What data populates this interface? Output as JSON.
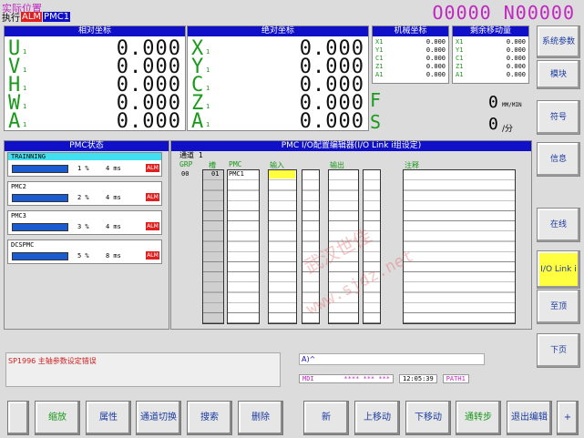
{
  "header": {
    "title": "实际位置",
    "mode_label": "执行",
    "mode_badge": "ALM",
    "path_badge": "PMC1",
    "program": "O0000 N00000"
  },
  "relative_coords": {
    "title": "相对坐标",
    "axes": [
      {
        "name": "U",
        "sub": "1",
        "value": "0.000"
      },
      {
        "name": "V",
        "sub": "1",
        "value": "0.000"
      },
      {
        "name": "H",
        "sub": "1",
        "value": "0.000"
      },
      {
        "name": "W",
        "sub": "1",
        "value": "0.000"
      },
      {
        "name": "A",
        "sub": "1",
        "value": "0.000"
      }
    ]
  },
  "absolute_coords": {
    "title": "绝对坐标",
    "axes": [
      {
        "name": "X",
        "sub": "1",
        "value": "0.000"
      },
      {
        "name": "Y",
        "sub": "1",
        "value": "0.000"
      },
      {
        "name": "C",
        "sub": "1",
        "value": "0.000"
      },
      {
        "name": "Z",
        "sub": "1",
        "value": "0.000"
      },
      {
        "name": "A",
        "sub": "1",
        "value": "0.000"
      }
    ]
  },
  "machine_coords": {
    "title": "机械坐标",
    "axes": [
      {
        "name": "X1",
        "value": "0.000"
      },
      {
        "name": "Y1",
        "value": "0.000"
      },
      {
        "name": "C1",
        "value": "0.000"
      },
      {
        "name": "Z1",
        "value": "0.000"
      },
      {
        "name": "A1",
        "value": "0.000"
      }
    ]
  },
  "remaining": {
    "title": "剩余移动量",
    "axes": [
      {
        "name": "X1",
        "value": "0.000"
      },
      {
        "name": "Y1",
        "value": "0.000"
      },
      {
        "name": "C1",
        "value": "0.000"
      },
      {
        "name": "Z1",
        "value": "0.000"
      },
      {
        "name": "A1",
        "value": "0.000"
      }
    ]
  },
  "feed": {
    "f_label": "F",
    "s_label": "S",
    "f_value": "0",
    "f_unit": "MM/MIN",
    "s_value": "0",
    "s_unit": "/分"
  },
  "pmc_status": {
    "title": "PMC状态",
    "items": [
      {
        "name": "TRAINNING",
        "load": 0.01,
        "percent": "1 %",
        "time": "4 ms",
        "alarm": "ALM"
      },
      {
        "name": "PMC2",
        "load": 0.02,
        "percent": "2 %",
        "time": "4 ms",
        "alarm": "ALM"
      },
      {
        "name": "PMC3",
        "load": 0.03,
        "percent": "3 %",
        "time": "4 ms",
        "alarm": "ALM"
      },
      {
        "name": "DCSPMC",
        "load": 0.05,
        "percent": "5 %",
        "time": "8 ms",
        "alarm": "ALM"
      }
    ]
  },
  "io_config": {
    "title": "PMC I/O配置编辑器(I/O Link i组设定)",
    "channel": "通道 1",
    "headers": {
      "grp": "GRP",
      "slot": "槽",
      "pmc": "PMC",
      "input": "输入",
      "output": "输出",
      "comment": "注释"
    },
    "row": {
      "grp": "00",
      "slot": "01",
      "pmc": "PMC1"
    }
  },
  "message": {
    "error": "SP1996 主轴参数设定错误",
    "input_prompt": "A)^",
    "status": {
      "mode": "MDI",
      "stars": "**** *** ***",
      "time": "12:05:39",
      "path": "PATH1"
    }
  },
  "watermark": {
    "cn": "武汉世佳",
    "url": "www.sjdz.net"
  },
  "right_softkeys": [
    {
      "label": "系统参数",
      "active": false
    },
    {
      "label": "模块",
      "active": false
    },
    {
      "label": "符号",
      "active": false
    },
    {
      "label": "信息",
      "active": false
    },
    {
      "label": "在线",
      "active": false
    },
    {
      "label": "I/O Link i",
      "active": true
    },
    {
      "label": "至顶",
      "active": false
    },
    {
      "label": "下页",
      "active": false
    }
  ],
  "bottom_softkeys": [
    {
      "label": "",
      "special": "blank"
    },
    {
      "label": "缩放",
      "green": true
    },
    {
      "label": "属性"
    },
    {
      "label": "通道切换"
    },
    {
      "label": "搜索"
    },
    {
      "label": "删除"
    },
    {
      "label": "新"
    },
    {
      "label": "上移动"
    },
    {
      "label": "下移动"
    },
    {
      "label": "通转步",
      "green": true
    },
    {
      "label": "退出编辑"
    },
    {
      "label": "+"
    }
  ],
  "colors": {
    "accent_header": "#1010c8",
    "axis_green": "#1a9a1a",
    "title_magenta": "#c026c0",
    "alarm_red": "#e02020",
    "active_key": "#ffff40",
    "selected_row": "#40e0f0"
  }
}
